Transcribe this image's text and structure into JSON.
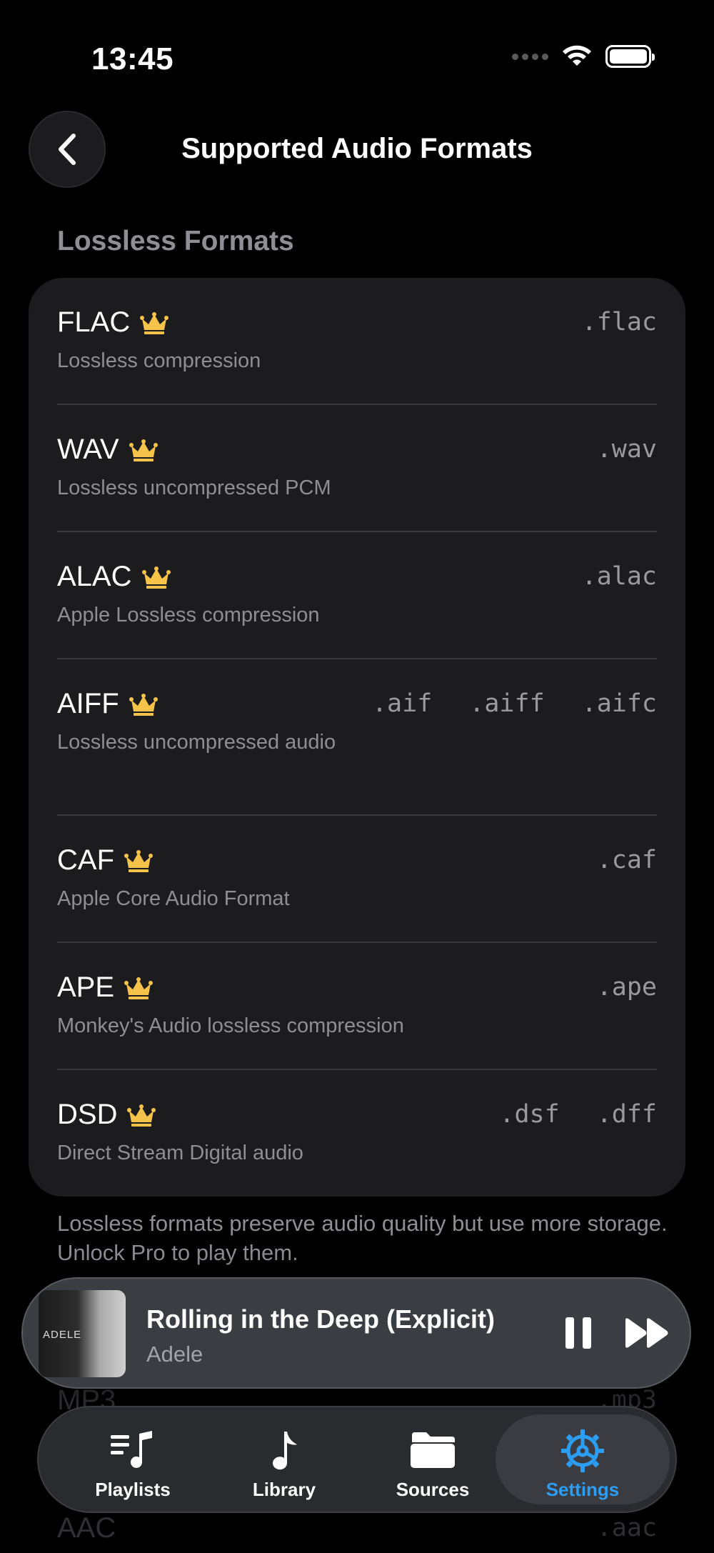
{
  "status_bar": {
    "time": "13:45"
  },
  "nav": {
    "title": "Supported Audio Formats"
  },
  "section": {
    "title": "Lossless Formats"
  },
  "formats": [
    {
      "name": "FLAC",
      "description": "Lossless compression",
      "extensions": [
        ".flac"
      ]
    },
    {
      "name": "WAV",
      "description": "Lossless uncompressed PCM",
      "extensions": [
        ".wav"
      ]
    },
    {
      "name": "ALAC",
      "description": "Apple Lossless compression",
      "extensions": [
        ".alac"
      ]
    },
    {
      "name": "AIFF",
      "description": "Lossless uncompressed audio",
      "extensions": [
        ".aif",
        ".aiff",
        ".aifc"
      ]
    },
    {
      "name": "CAF",
      "description": "Apple Core Audio Format",
      "extensions": [
        ".caf"
      ]
    },
    {
      "name": "APE",
      "description": "Monkey's Audio lossless compression",
      "extensions": [
        ".ape"
      ]
    },
    {
      "name": "DSD",
      "description": "Direct Stream Digital audio",
      "extensions": [
        ".dsf",
        ".dff"
      ]
    }
  ],
  "footnote": "Lossless formats preserve audio quality but use more storage. Unlock Pro to play them.",
  "behind_content": [
    {
      "name": "MP3",
      "extension": ".mp3"
    },
    {
      "name": "AAC",
      "extension": ".aac"
    }
  ],
  "now_playing": {
    "title": "Rolling in the Deep (Explicit)",
    "artist": "Adele",
    "album_art_text": "ADELE"
  },
  "tabs": [
    {
      "label": "Playlists",
      "icon": "playlists-icon"
    },
    {
      "label": "Library",
      "icon": "music-note-icon"
    },
    {
      "label": "Sources",
      "icon": "folder-icon"
    },
    {
      "label": "Settings",
      "icon": "gear-icon",
      "active": true
    }
  ],
  "colors": {
    "accent": "#2b9df2",
    "crown": "#f6c34a",
    "card": "#1c1c1e",
    "secondary_text": "#8e8e93"
  }
}
